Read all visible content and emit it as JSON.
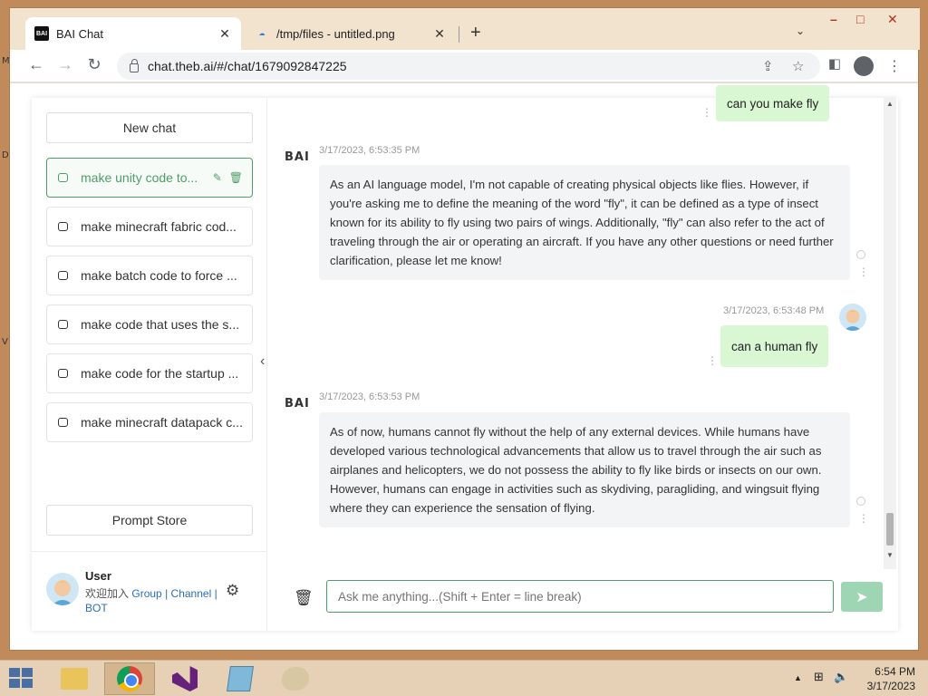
{
  "browser": {
    "tabs": [
      {
        "favicon": "bai-favicon",
        "title": "BAI Chat"
      },
      {
        "favicon": "cloud-favicon",
        "title": "/tmp/files - untitled.png"
      }
    ],
    "url": "chat.theb.ai/#/chat/1679092847225"
  },
  "sidebar": {
    "new_chat": "New chat",
    "chats": [
      {
        "label": "make unity code to..."
      },
      {
        "label": "make minecraft fabric cod..."
      },
      {
        "label": "make batch code to force ..."
      },
      {
        "label": "make code that uses the s..."
      },
      {
        "label": "make code for the startup ..."
      },
      {
        "label": "make minecraft datapack c..."
      }
    ],
    "prompt_store": "Prompt Store",
    "user": {
      "name": "User",
      "welcome": "欢迎加入",
      "link_group": "Group",
      "link_channel": "Channel",
      "link_bot": "BOT",
      "sep": "|"
    }
  },
  "chat": {
    "bot_name": "BAI",
    "messages": [
      {
        "role": "user",
        "text": "can you make fly"
      },
      {
        "role": "assistant",
        "time": "3/17/2023, 6:53:35 PM",
        "text": "As an AI language model, I'm not capable of creating physical objects like flies. However, if you're asking me to define the meaning of the word \"fly\", it can be defined as a type of insect known for its ability to fly using two pairs of wings. Additionally, \"fly\" can also refer to the act of traveling through the air or operating an aircraft. If you have any other questions or need further clarification, please let me know!"
      },
      {
        "role": "user",
        "time": "3/17/2023, 6:53:48 PM",
        "text": "can a human fly"
      },
      {
        "role": "assistant",
        "time": "3/17/2023, 6:53:53 PM",
        "text": "As of now, humans cannot fly without the help of any external devices. While humans have developed various technological advancements that allow us to travel through the air such as airplanes and helicopters, we do not possess the ability to fly like birds or insects on our own. However, humans can engage in activities such as skydiving, paragliding, and wingsuit flying where they can experience the sensation of flying."
      }
    ],
    "input_placeholder": "Ask me anything...(Shift + Enter = line break)"
  },
  "taskbar": {
    "time": "6:54 PM",
    "date": "3/17/2023"
  },
  "colors": {
    "accent": "#4f9d69",
    "user_bubble": "#d9f7d3",
    "ai_bubble": "#f3f4f6",
    "send_button": "#9ed6b3"
  }
}
